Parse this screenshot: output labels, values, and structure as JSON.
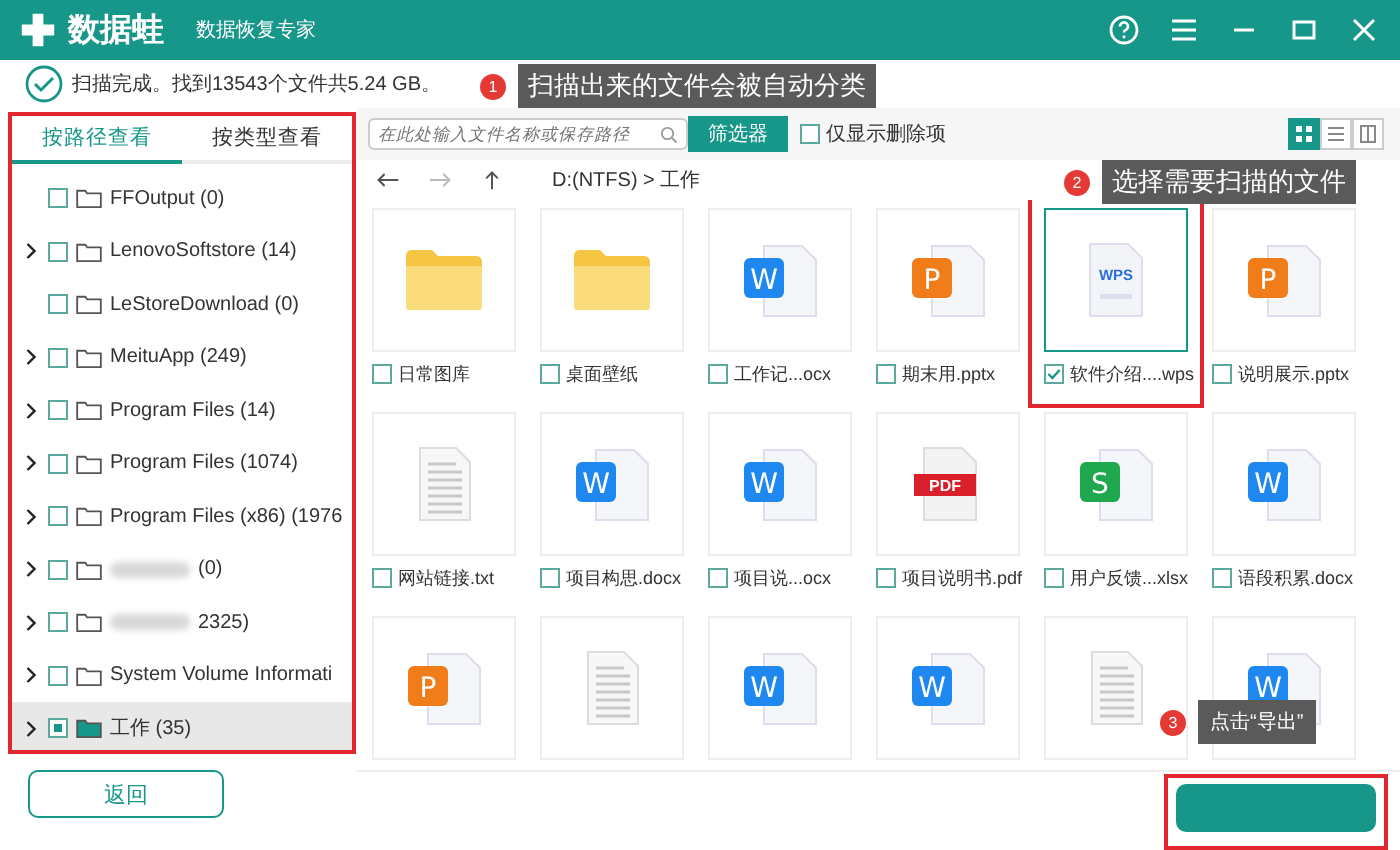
{
  "app": {
    "name": "数据蛙",
    "subtitle": "数据恢复专家"
  },
  "status": {
    "message": "扫描完成。找到13543个文件共5.24 GB。"
  },
  "sidebar": {
    "annotated": true,
    "tabs": [
      {
        "label": "按路径查看",
        "selected": true
      },
      {
        "label": "按类型查看",
        "selected": false
      }
    ],
    "tree": [
      {
        "label": "FFOutput (0)",
        "expandable": false,
        "checked": false,
        "selected": false,
        "redacted": false
      },
      {
        "label": "LenovoSoftstore (14)",
        "expandable": true,
        "checked": false,
        "selected": false,
        "redacted": false
      },
      {
        "label": "LeStoreDownload (0)",
        "expandable": false,
        "checked": false,
        "selected": false,
        "redacted": false
      },
      {
        "label": "MeituApp (249)",
        "expandable": true,
        "checked": false,
        "selected": false,
        "redacted": false
      },
      {
        "label": "Program Files (14)",
        "expandable": true,
        "checked": false,
        "selected": false,
        "redacted": false
      },
      {
        "label": "Program Files (1074)",
        "expandable": true,
        "checked": false,
        "selected": false,
        "redacted": false
      },
      {
        "label": "Program Files (x86) (1976",
        "expandable": true,
        "checked": false,
        "selected": false,
        "redacted": false
      },
      {
        "label": "(0)",
        "expandable": true,
        "checked": false,
        "selected": false,
        "redacted": true
      },
      {
        "label": "2325)",
        "expandable": true,
        "checked": false,
        "selected": false,
        "redacted": true
      },
      {
        "label": "System Volume Informati",
        "expandable": true,
        "checked": false,
        "selected": false,
        "redacted": false
      },
      {
        "label": "工作 (35)",
        "expandable": true,
        "checked": true,
        "selected": true,
        "redacted": false
      }
    ],
    "back_button": "返回"
  },
  "toolbar": {
    "search": {
      "placeholder": "在此处输入文件名称或保存路径"
    },
    "filter_button": "筛选器",
    "deleted_only": {
      "label": "仅显示删除项",
      "checked": false
    },
    "views": [
      {
        "kind": "grid",
        "selected": true
      },
      {
        "kind": "list",
        "selected": false
      },
      {
        "kind": "columns",
        "selected": false
      }
    ]
  },
  "path": "D:(NTFS) > 工作",
  "files": [
    {
      "name": "日常图库",
      "kind": "folder",
      "checked": false,
      "selected": false,
      "annotated": false
    },
    {
      "name": "桌面壁纸",
      "kind": "folder",
      "checked": false,
      "selected": false,
      "annotated": false
    },
    {
      "name": "工作记...ocx",
      "kind": "word",
      "icon_text": "W",
      "checked": false,
      "selected": false,
      "annotated": false
    },
    {
      "name": "期末用.pptx",
      "kind": "ppt",
      "icon_text": "P",
      "checked": false,
      "selected": false,
      "annotated": false
    },
    {
      "name": "软件介绍....wps",
      "kind": "wps",
      "icon_text": "WPS",
      "checked": true,
      "selected": true,
      "annotated": true
    },
    {
      "name": "说明展示.pptx",
      "kind": "ppt",
      "icon_text": "P",
      "checked": false,
      "selected": false,
      "annotated": false
    },
    {
      "name": "网站链接.txt",
      "kind": "txt",
      "checked": false,
      "selected": false,
      "annotated": false
    },
    {
      "name": "项目构思.docx",
      "kind": "word",
      "icon_text": "W",
      "checked": false,
      "selected": false,
      "annotated": false
    },
    {
      "name": "项目说...ocx",
      "kind": "word",
      "icon_text": "W",
      "checked": false,
      "selected": false,
      "annotated": false
    },
    {
      "name": "项目说明书.pdf",
      "kind": "pdf",
      "icon_text": "PDF",
      "checked": false,
      "selected": false,
      "annotated": false
    },
    {
      "name": "用户反馈...xlsx",
      "kind": "excel",
      "icon_text": "S",
      "checked": false,
      "selected": false,
      "annotated": false
    },
    {
      "name": "语段积累.docx",
      "kind": "word",
      "icon_text": "W",
      "checked": false,
      "selected": false,
      "annotated": false
    },
    {
      "kind": "ppt",
      "icon_text": "P",
      "selected": false,
      "annotated": false
    },
    {
      "kind": "txt",
      "selected": false,
      "annotated": false
    },
    {
      "kind": "word",
      "icon_text": "W",
      "selected": false,
      "annotated": false
    },
    {
      "kind": "word",
      "icon_text": "W",
      "selected": false,
      "annotated": false
    },
    {
      "kind": "txt",
      "selected": false,
      "annotated": false
    },
    {
      "kind": "word",
      "icon_text": "W",
      "selected": false,
      "annotated": false
    }
  ],
  "export_annotated": true,
  "callouts": [
    {
      "number": "1",
      "text": "扫描出来的文件会被自动分类"
    },
    {
      "number": "2",
      "text": "选择需要扫描的文件"
    },
    {
      "number": "3",
      "text": "点击“导出”"
    }
  ]
}
